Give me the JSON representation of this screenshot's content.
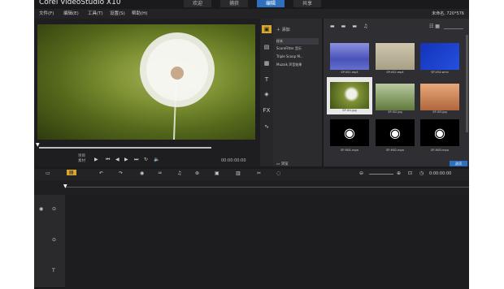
{
  "app": {
    "title": "Corel VideoStudio X10"
  },
  "tabs": [
    {
      "label": "欢迎"
    },
    {
      "label": "捕获"
    },
    {
      "label": "编辑"
    },
    {
      "label": "共享"
    }
  ],
  "menu": {
    "items": [
      {
        "label": "文件(F)"
      },
      {
        "label": "编辑(E)"
      },
      {
        "label": "工具(T)"
      },
      {
        "label": "设置(S)"
      },
      {
        "label": "帮助(H)"
      }
    ],
    "project_info": "未命名, 720*576"
  },
  "preview": {
    "mode_project": "项目",
    "mode_clip": "素材",
    "timecode": "00:00:00:00"
  },
  "library": {
    "add_label": "添加",
    "folders": [
      {
        "label": "样本"
      },
      {
        "label": "ScoreFitter 音乐"
      },
      {
        "label": "Triple Scoop M..."
      },
      {
        "label": "Muzaik 声音效果"
      }
    ],
    "browse_label": "浏览",
    "apply_label": "选项",
    "thumbs": [
      {
        "name": "SP-V01.mp4",
        "kind": "video"
      },
      {
        "name": "SP-V02.mp4",
        "kind": "video"
      },
      {
        "name": "SP-V04.wmv",
        "kind": "video"
      },
      {
        "name": "SP-I01.jpg",
        "kind": "image"
      },
      {
        "name": "SP-I02.jpg",
        "kind": "image"
      },
      {
        "name": "SP-I03.jpg",
        "kind": "image"
      },
      {
        "name": "SP-M01.mpa",
        "kind": "audio"
      },
      {
        "name": "SP-M02.mpa",
        "kind": "audio"
      },
      {
        "name": "SP-M03.mpa",
        "kind": "audio"
      }
    ]
  },
  "timeline": {
    "timecode": "0:00:00:00"
  },
  "colors": {
    "accent": "#2e6fbf",
    "background": "#1b1b1d"
  }
}
